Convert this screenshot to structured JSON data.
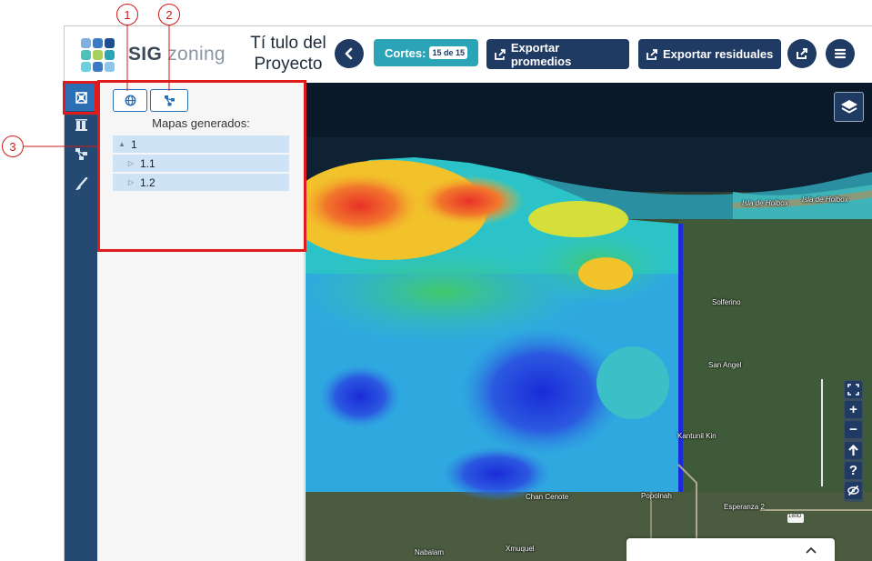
{
  "header": {
    "brand_sig": "SIG",
    "brand_zoning": "zoning",
    "project_title": "Tí tulo del Proyecto",
    "back_icon": "chevron-left-icon",
    "cortes_label": "Cortes:",
    "cortes_value": "15 de 15",
    "export_averages_label": "Exportar promedios",
    "export_residuals_label": "Exportar residuales",
    "share_icon": "share-icon",
    "menu_icon": "hamburger-menu-icon"
  },
  "rail": {
    "items": [
      {
        "icon": "maps-icon",
        "active": true
      },
      {
        "icon": "layers-stack-icon",
        "active": false
      },
      {
        "icon": "tree-hierarchy-icon",
        "active": false
      },
      {
        "icon": "brush-icon",
        "active": false
      }
    ]
  },
  "panel": {
    "tabs": [
      {
        "icon": "globe-icon"
      },
      {
        "icon": "hierarchy-icon"
      }
    ],
    "heading": "Mapas generados:",
    "tree": [
      {
        "label": "1",
        "expanded": true,
        "level": 0
      },
      {
        "label": "1.1",
        "expanded": false,
        "level": 1
      },
      {
        "label": "1.2",
        "expanded": false,
        "level": 1
      }
    ]
  },
  "map": {
    "labels": {
      "isla_holbox_1": "Isla de Holbox",
      "isla_holbox_2": "Isla de Holbox",
      "solferino": "Solferino",
      "san_angel": "San Angel",
      "kantunil_kin": "Kantunil Kin",
      "chan_cenote": "Chan Cenote",
      "popolnah": "Popolnah",
      "esperanza": "Esperanza 2",
      "road_sign": "180D",
      "nabalam": "Nabalam",
      "xmuquel": "Xmuquel"
    },
    "controls": {
      "layers_icon": "layers-icon",
      "fullscreen_icon": "fullscreen-icon",
      "zoom_in": "+",
      "zoom_out": "−",
      "home_icon": "arrow-up-icon",
      "help": "?",
      "hide_icon": "eye-slash-icon"
    },
    "bottom_card_icon": "chevron-up-icon"
  },
  "annotations": {
    "one": "1",
    "two": "2",
    "three": "3"
  },
  "colors": {
    "navy": "#1f3a63",
    "teal": "#2aa4b6",
    "rail": "#244a73",
    "highlight": "#e01b1b",
    "tree_row": "#cfe3f7"
  }
}
